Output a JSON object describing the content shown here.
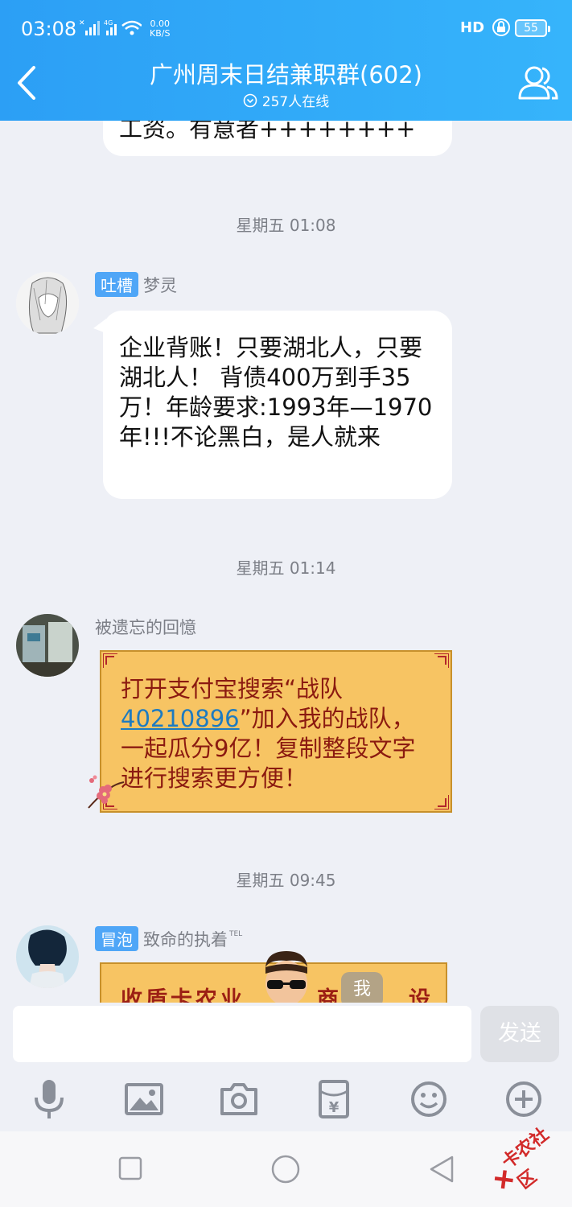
{
  "status_bar": {
    "time": "03:08",
    "net_speed_value": "0.00",
    "net_speed_unit": "KB/S",
    "battery": "55",
    "hd_label": "HD",
    "sig_label": "4G"
  },
  "header": {
    "title": "广州周末日结兼职群(602)",
    "online": "257人在线"
  },
  "messages": {
    "m0": {
      "text": "工资。有意者++++++++"
    },
    "ts1": "星期五 01:08",
    "m1": {
      "tag": "吐槽",
      "sender": "梦灵",
      "text": "企业背账！只要湖北人，只要湖北人！ 背债400万到手35万！年龄要求:1993年—1970年!!!不论黑白，是人就来"
    },
    "ts2": "星期五 01:14",
    "m2": {
      "sender": "被遗忘的回憶",
      "text_a": "打开支付宝搜索“战队",
      "link": "40210896",
      "text_b": "”加入我的战队，一起瓜分9亿！复制整段文字进行搜索更方便！"
    },
    "ts3": "星期五 09:45",
    "m3": {
      "tag": "冒泡",
      "sender": "致命的执着",
      "sender_badge": "TEL",
      "banner_text": "收盾卡农业",
      "banner_text2": "设",
      "banner_mid": "商",
      "float_label": "我"
    }
  },
  "input": {
    "placeholder": "",
    "send_label": "发送"
  },
  "toolbar": [
    "mic-icon",
    "image-icon",
    "camera-icon",
    "red-packet-icon",
    "emoji-icon",
    "plus-icon"
  ],
  "watermark": {
    "text": "卡农社区"
  }
}
